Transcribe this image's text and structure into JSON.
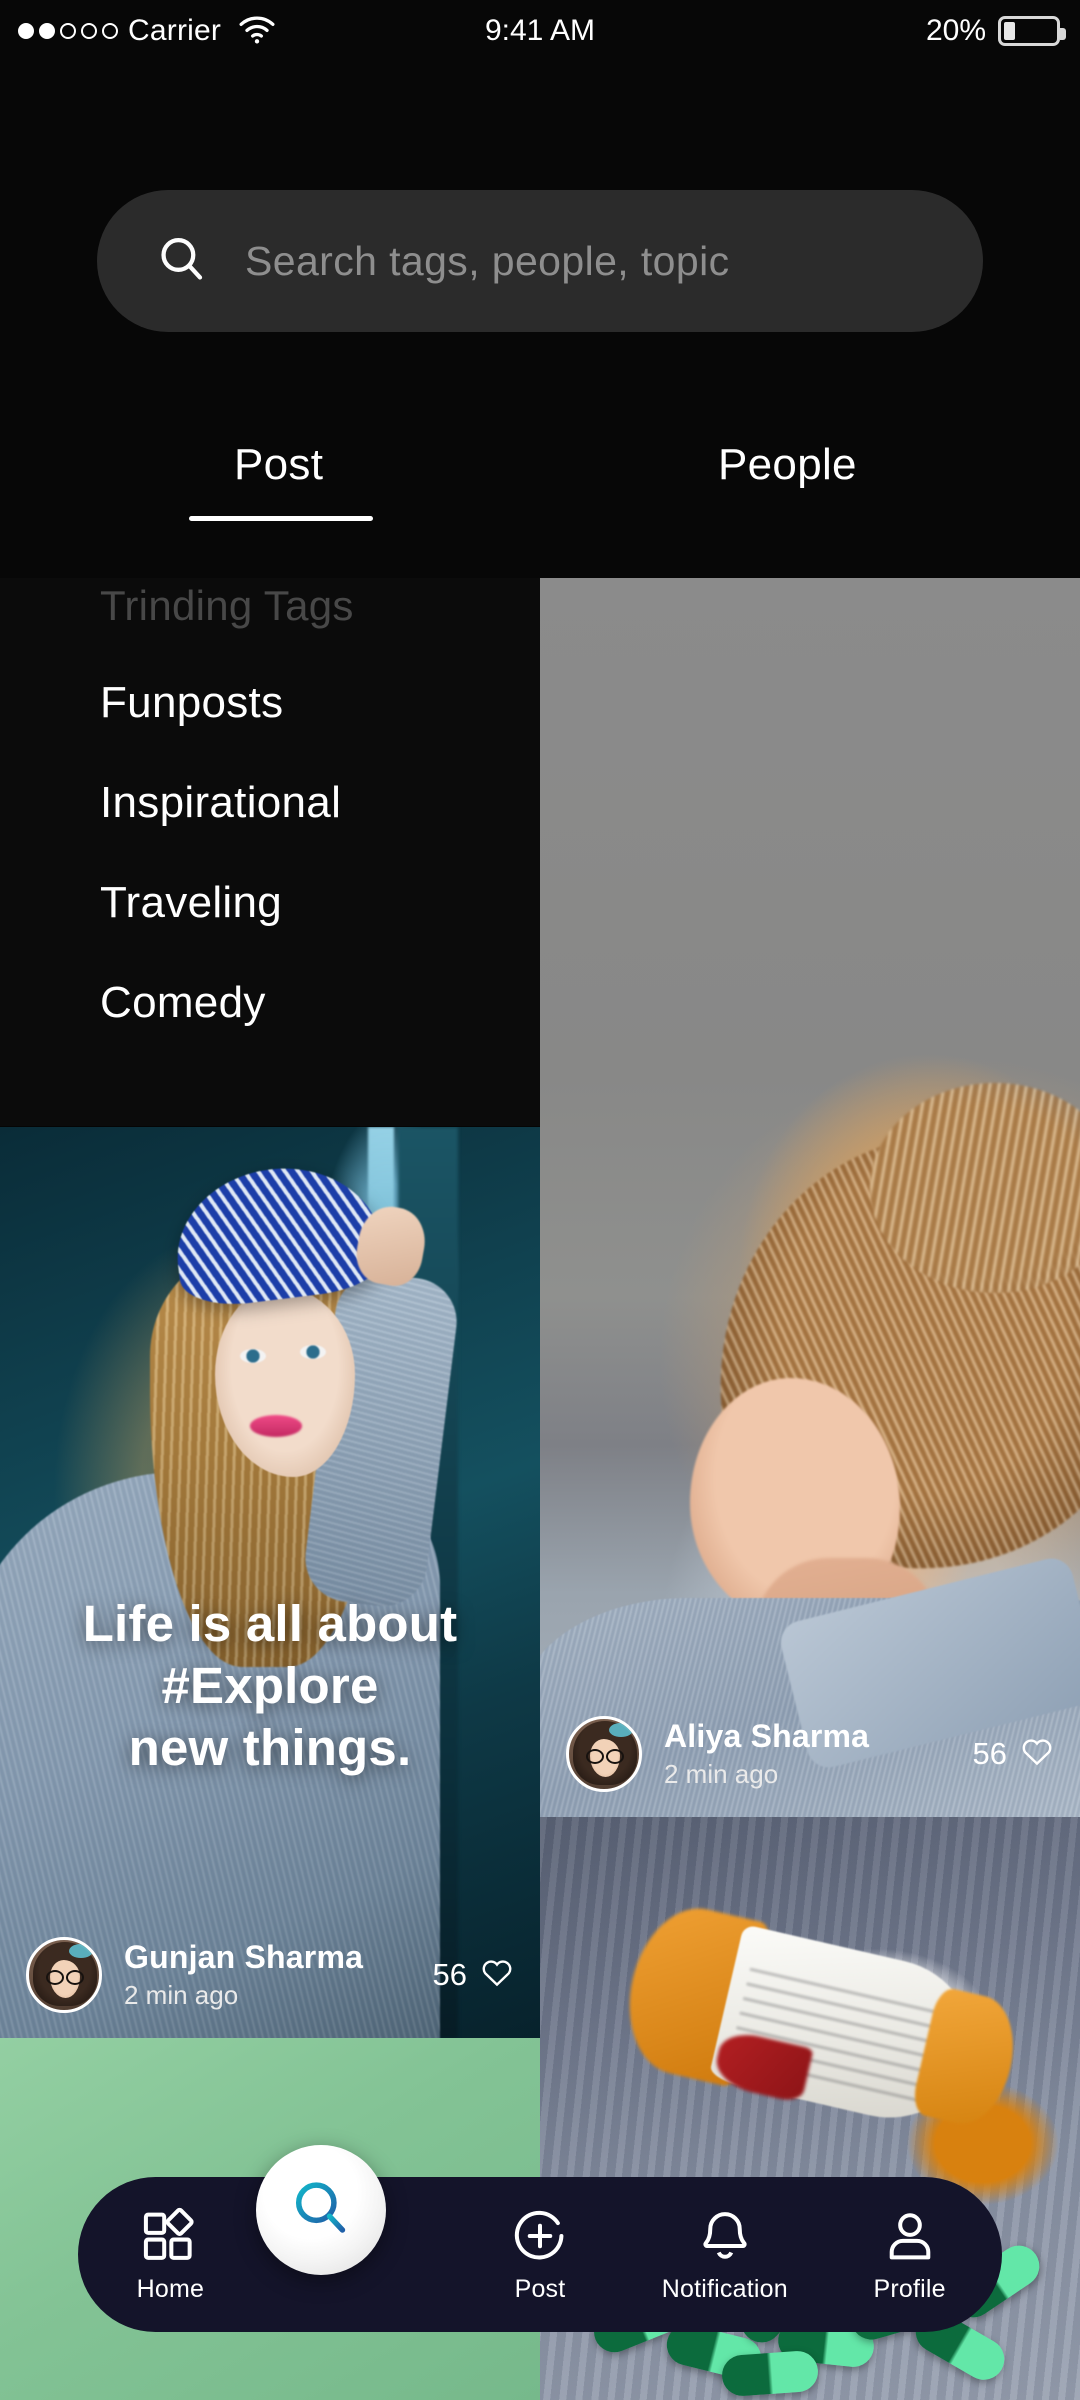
{
  "statusbar": {
    "carrier": "Carrier",
    "time": "9:41 AM",
    "battery_percent": "20%",
    "signal_dots_filled": 2,
    "signal_dots_total": 5,
    "wifi_icon": "wifi-icon",
    "battery_icon": "battery-icon"
  },
  "search": {
    "placeholder": "Search tags, people, topic",
    "value": "",
    "icon": "search-icon"
  },
  "tabs": [
    {
      "label": "Post",
      "active": true
    },
    {
      "label": "People",
      "active": false
    }
  ],
  "trending": {
    "title": "Trinding Tags",
    "items": [
      {
        "label": "Funposts"
      },
      {
        "label": "Inspirational"
      },
      {
        "label": "Traveling"
      },
      {
        "label": "Comedy"
      }
    ]
  },
  "feed": {
    "posts": [
      {
        "id": "aliya",
        "caption": "",
        "author": "Aliya Sharma",
        "time": "2 min ago",
        "likes": "56",
        "like_icon": "heart-icon",
        "avatar": "avatar"
      },
      {
        "id": "gunjan",
        "caption": "Life is all about\n#Explore\nnew things.",
        "caption_line1": "Life is all about",
        "caption_line2": "#Explore",
        "caption_line3": "new things.",
        "author": "Gunjan Sharma",
        "time": "2 min ago",
        "likes": "56",
        "like_icon": "heart-icon",
        "avatar": "avatar"
      },
      {
        "id": "pills",
        "caption": "",
        "author": "",
        "time": "",
        "likes": ""
      },
      {
        "id": "green",
        "caption": "",
        "author": "",
        "time": "",
        "likes": ""
      }
    ]
  },
  "bottomnav": {
    "items": [
      {
        "label": "Home",
        "icon": "grid-icon",
        "active": false
      },
      {
        "label": "",
        "icon": "search-icon",
        "active": true
      },
      {
        "label": "Post",
        "icon": "plus-circle-icon",
        "active": false
      },
      {
        "label": "Notification",
        "icon": "bell-icon",
        "active": false
      },
      {
        "label": "Profile",
        "icon": "person-icon",
        "active": false
      }
    ]
  },
  "colors": {
    "background": "#050505",
    "search_field": "#2b2b2b",
    "nav_bar": "#14142a",
    "accent_search": "#1b9bc4",
    "green_card": "#83c395",
    "muted_text": "#8e8e8e",
    "tags_title": "#484848"
  }
}
